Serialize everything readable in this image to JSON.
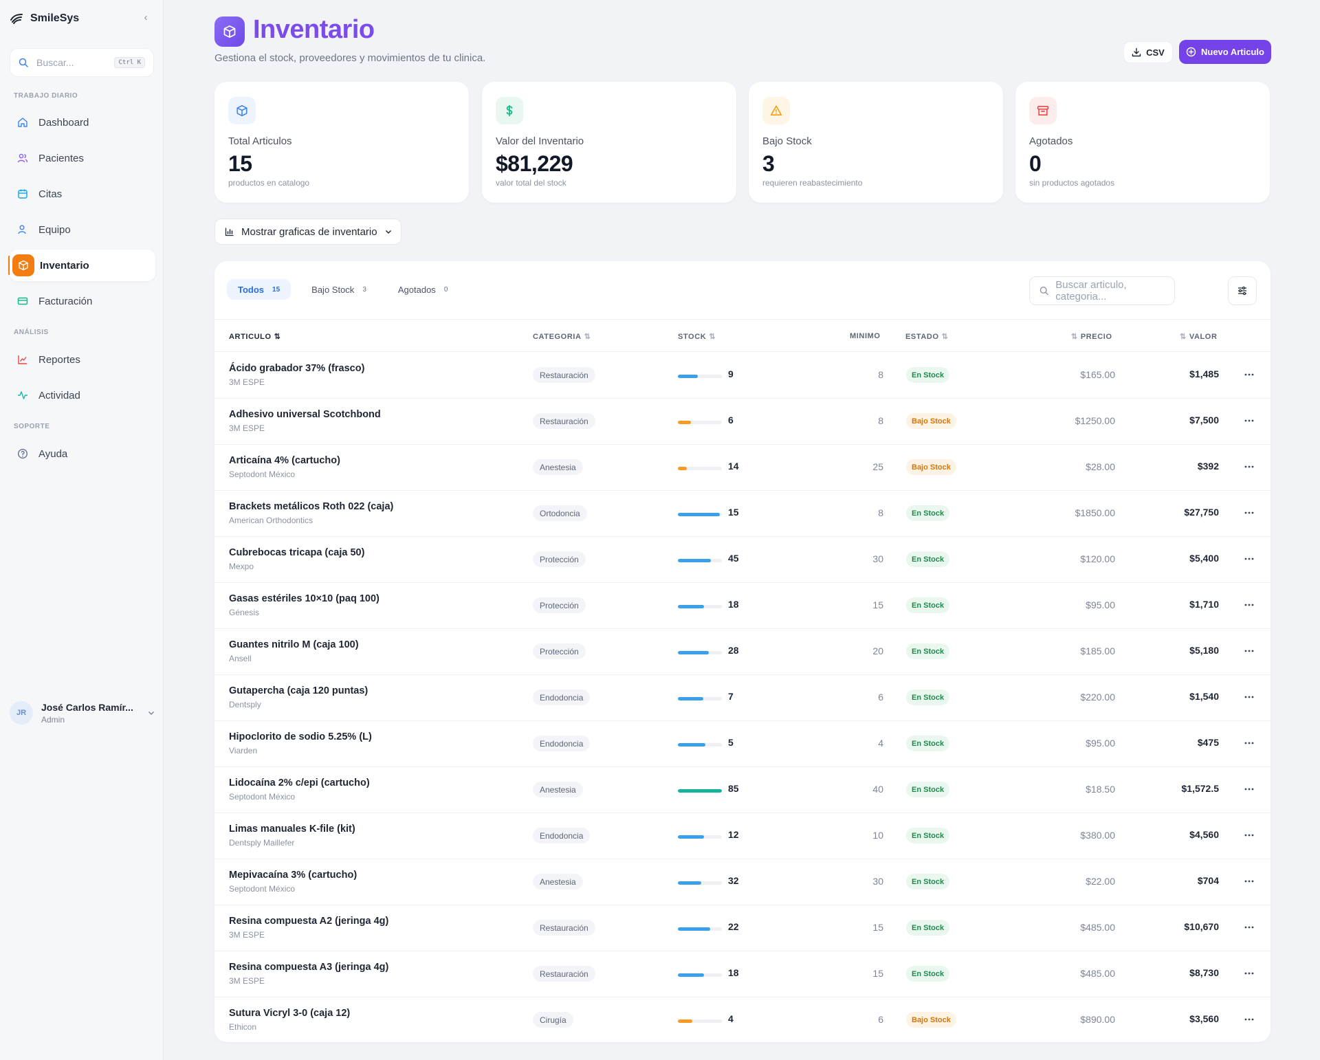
{
  "app": {
    "name": "SmileSys"
  },
  "sidebar": {
    "search_placeholder": "Buscar...",
    "search_shortcut": "Ctrl K",
    "sections": [
      "TRABAJO DIARIO",
      "ANÁLISIS",
      "SOPORTE"
    ],
    "items": [
      {
        "label": "Dashboard",
        "icon": "home-icon",
        "color": "#3b82f6"
      },
      {
        "label": "Pacientes",
        "icon": "users-icon",
        "color": "#8b5cf6"
      },
      {
        "label": "Citas",
        "icon": "calendar-icon",
        "color": "#0ea5e9"
      },
      {
        "label": "Equipo",
        "icon": "user-icon",
        "color": "#3b82f6"
      },
      {
        "label": "Inventario",
        "icon": "box-icon",
        "color": "#f47d12"
      },
      {
        "label": "Facturación",
        "icon": "card-icon",
        "color": "#10b981"
      },
      {
        "label": "Reportes",
        "icon": "chart-line-icon",
        "color": "#ef4444"
      },
      {
        "label": "Actividad",
        "icon": "activity-icon",
        "color": "#14b8a6"
      },
      {
        "label": "Ayuda",
        "icon": "help-icon",
        "color": "#64748b"
      }
    ],
    "active_item": "Inventario",
    "user": {
      "initials": "JR",
      "name": "José Carlos Ramír...",
      "role": "Admin"
    }
  },
  "header": {
    "title": "Inventario",
    "subtitle": "Gestiona el stock, proveedores y movimientos de tu clinica.",
    "csv_label": "CSV",
    "new_label": "Nuevo Articulo"
  },
  "kpis": [
    {
      "label": "Total Articulos",
      "value": "15",
      "desc": "productos en catalogo",
      "icon": "box-icon",
      "color": "#3b82f6"
    },
    {
      "label": "Valor del Inventario",
      "value": "$81,229",
      "desc": "valor total del stock",
      "icon": "dollar-icon",
      "color": "#10b981"
    },
    {
      "label": "Bajo Stock",
      "value": "3",
      "desc": "requieren reabastecimiento",
      "icon": "warning-icon",
      "color": "#f59e0b"
    },
    {
      "label": "Agotados",
      "value": "0",
      "desc": "sin productos agotados",
      "icon": "archive-icon",
      "color": "#ef4444"
    }
  ],
  "charts_toggle_label": "Mostrar graficas de inventario",
  "tabs": [
    {
      "label": "Todos",
      "count": "15"
    },
    {
      "label": "Bajo Stock",
      "count": "3"
    },
    {
      "label": "Agotados",
      "count": "0"
    }
  ],
  "active_tab": "Todos",
  "table_search_placeholder": "Buscar articulo, categoria...",
  "columns": {
    "articulo": "ARTICULO",
    "categoria": "CATEGORIA",
    "stock": "STOCK",
    "minimo": "MINIMO",
    "estado": "ESTADO",
    "precio": "PRECIO",
    "valor": "VALOR"
  },
  "status_colors": {
    "En Stock": "#1f8a4d",
    "Bajo Stock": "#d97508"
  },
  "rows": [
    {
      "name": "Ácido grabador 37% (frasco)",
      "supplier": "3M ESPE",
      "category": "Restauración",
      "stock": "9",
      "stock_level": 0.45,
      "stock_state": "ok",
      "min": "8",
      "status": "En Stock",
      "price": "$165.00",
      "value": "$1,485"
    },
    {
      "name": "Adhesivo universal Scotchbond",
      "supplier": "3M ESPE",
      "category": "Restauración",
      "stock": "6",
      "stock_level": 0.3,
      "stock_state": "low",
      "min": "8",
      "status": "Bajo Stock",
      "price": "$1250.00",
      "value": "$7,500"
    },
    {
      "name": "Articaína 4% (cartucho)",
      "supplier": "Septodont México",
      "category": "Anestesia",
      "stock": "14",
      "stock_level": 0.2,
      "stock_state": "low",
      "min": "25",
      "status": "Bajo Stock",
      "price": "$28.00",
      "value": "$392"
    },
    {
      "name": "Brackets metálicos Roth 022 (caja)",
      "supplier": "American Orthodontics",
      "category": "Ortodoncia",
      "stock": "15",
      "stock_level": 0.95,
      "stock_state": "ok",
      "min": "8",
      "status": "En Stock",
      "price": "$1850.00",
      "value": "$27,750"
    },
    {
      "name": "Cubrebocas tricapa (caja 50)",
      "supplier": "Mexpo",
      "category": "Protección",
      "stock": "45",
      "stock_level": 0.75,
      "stock_state": "ok",
      "min": "30",
      "status": "En Stock",
      "price": "$120.00",
      "value": "$5,400"
    },
    {
      "name": "Gasas estériles 10×10 (paq 100)",
      "supplier": "Génesis",
      "category": "Protección",
      "stock": "18",
      "stock_level": 0.6,
      "stock_state": "ok",
      "min": "15",
      "status": "En Stock",
      "price": "$95.00",
      "value": "$1,710"
    },
    {
      "name": "Guantes nitrilo M (caja 100)",
      "supplier": "Ansell",
      "category": "Protección",
      "stock": "28",
      "stock_level": 0.7,
      "stock_state": "ok",
      "min": "20",
      "status": "En Stock",
      "price": "$185.00",
      "value": "$5,180"
    },
    {
      "name": "Gutapercha (caja 120 puntas)",
      "supplier": "Dentsply",
      "category": "Endodoncia",
      "stock": "7",
      "stock_level": 0.58,
      "stock_state": "ok",
      "min": "6",
      "status": "En Stock",
      "price": "$220.00",
      "value": "$1,540"
    },
    {
      "name": "Hipoclorito de sodio 5.25% (L)",
      "supplier": "Viarden",
      "category": "Endodoncia",
      "stock": "5",
      "stock_level": 0.62,
      "stock_state": "ok",
      "min": "4",
      "status": "En Stock",
      "price": "$95.00",
      "value": "$475"
    },
    {
      "name": "Lidocaína 2% c/epi (cartucho)",
      "supplier": "Septodont México",
      "category": "Anestesia",
      "stock": "85",
      "stock_level": 1.0,
      "stock_state": "high",
      "min": "40",
      "status": "En Stock",
      "price": "$18.50",
      "value": "$1,572.5"
    },
    {
      "name": "Limas manuales K-file (kit)",
      "supplier": "Dentsply Maillefer",
      "category": "Endodoncia",
      "stock": "12",
      "stock_level": 0.6,
      "stock_state": "ok",
      "min": "10",
      "status": "En Stock",
      "price": "$380.00",
      "value": "$4,560"
    },
    {
      "name": "Mepivacaína 3% (cartucho)",
      "supplier": "Septodont México",
      "category": "Anestesia",
      "stock": "32",
      "stock_level": 0.53,
      "stock_state": "ok",
      "min": "30",
      "status": "En Stock",
      "price": "$22.00",
      "value": "$704"
    },
    {
      "name": "Resina compuesta A2 (jeringa 4g)",
      "supplier": "3M ESPE",
      "category": "Restauración",
      "stock": "22",
      "stock_level": 0.73,
      "stock_state": "ok",
      "min": "15",
      "status": "En Stock",
      "price": "$485.00",
      "value": "$10,670"
    },
    {
      "name": "Resina compuesta A3 (jeringa 4g)",
      "supplier": "3M ESPE",
      "category": "Restauración",
      "stock": "18",
      "stock_level": 0.6,
      "stock_state": "ok",
      "min": "15",
      "status": "En Stock",
      "price": "$485.00",
      "value": "$8,730"
    },
    {
      "name": "Sutura Vicryl 3-0 (caja 12)",
      "supplier": "Ethicon",
      "category": "Cirugía",
      "stock": "4",
      "stock_level": 0.33,
      "stock_state": "low",
      "min": "6",
      "status": "Bajo Stock",
      "price": "$890.00",
      "value": "$3,560"
    }
  ]
}
